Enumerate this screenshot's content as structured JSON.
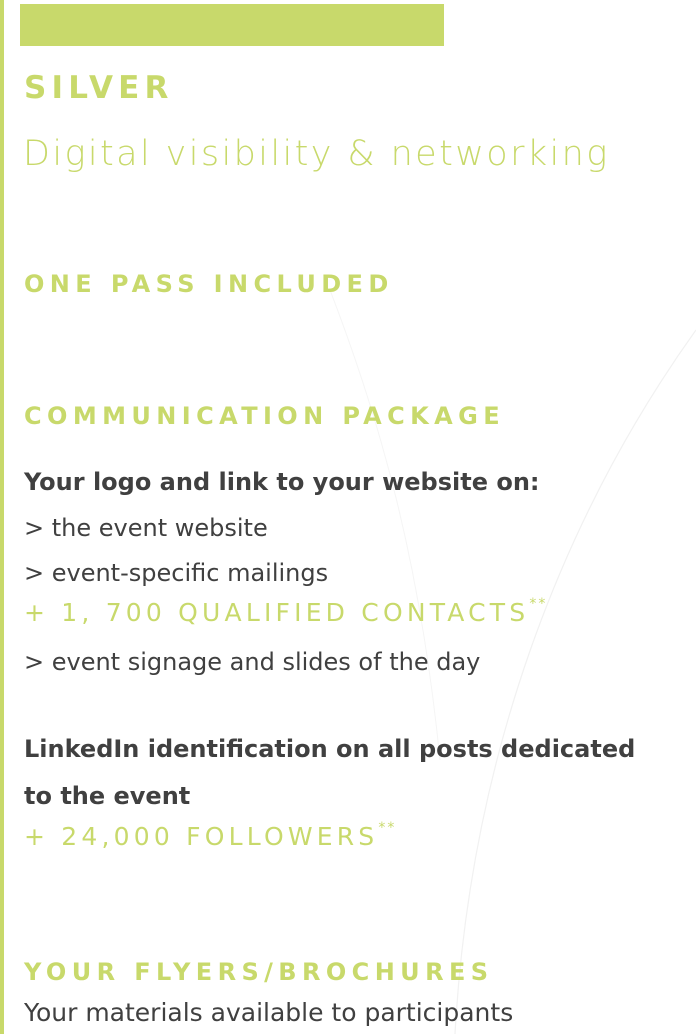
{
  "tier": {
    "name": "SILVER",
    "subtitle": "Digital visibility & networking"
  },
  "pass": {
    "heading": "ONE PASS INCLUDED"
  },
  "communication": {
    "heading": "COMMUNICATION PACKAGE",
    "logo_intro": "Your logo and link to your website on:",
    "items": [
      "> the event website",
      "> event-specific mailings"
    ],
    "contacts_stat": "+ 1, 700 QUALIFIED CONTACTS",
    "contacts_mark": "**",
    "signage_item": "> event signage and slides of the day",
    "linkedin_line1": "LinkedIn identification on all posts dedicated",
    "linkedin_line2": "to the event",
    "followers_stat": "+ 24,000 FOLLOWERS",
    "followers_mark": "**"
  },
  "flyers": {
    "heading": "YOUR FLYERS/BROCHURES",
    "description": "Your materials available to participants"
  },
  "colors": {
    "accent": "#c8d96b",
    "text": "#404040"
  }
}
